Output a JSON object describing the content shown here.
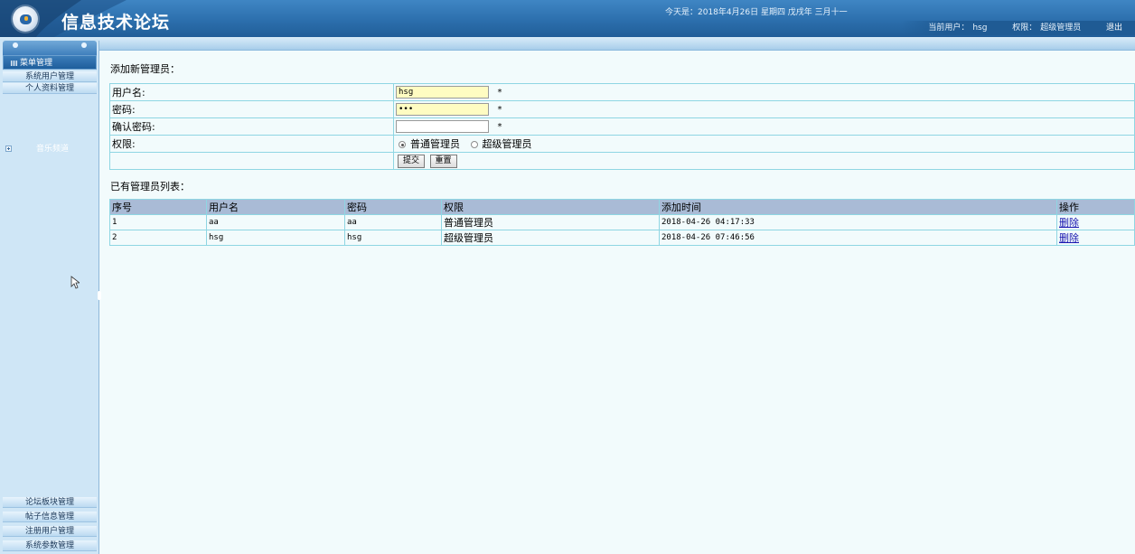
{
  "header": {
    "site_title": "信息技术论坛",
    "today_label": "今天是：2018年4月26日 星期四 戊戌年 三月十一",
    "current_user_label": "当前用户：",
    "current_user": "hsg",
    "role_label": "权限：",
    "role": "超级管理员",
    "logout": "退出"
  },
  "sidebar": {
    "menu_header": "菜单管理",
    "top_items": [
      "系统用户管理",
      "个人资料管理"
    ],
    "tree_item": "音乐频道",
    "bottom_items": [
      "论坛板块管理",
      "帖子信息管理",
      "注册用户管理",
      "系统参数管理"
    ]
  },
  "form": {
    "section_title": "添加新管理员：",
    "username_label": "用户名:",
    "username_value": "hsg",
    "password_label": "密码:",
    "password_value": "•••",
    "confirm_label": "确认密码:",
    "confirm_value": "",
    "required_mark": "*",
    "role_label": "权限:",
    "role_options": [
      "普通管理员",
      "超级管理员"
    ],
    "role_selected": "普通管理员",
    "submit_label": "提交",
    "reset_label": "重置"
  },
  "list": {
    "section_title": "已有管理员列表：",
    "columns": [
      "序号",
      "用户名",
      "密码",
      "权限",
      "添加时间",
      "操作"
    ],
    "rows": [
      {
        "id": "1",
        "username": "aa",
        "password": "aa",
        "role": "普通管理员",
        "added": "2018-04-26 04:17:33",
        "action": "删除"
      },
      {
        "id": "2",
        "username": "hsg",
        "password": "hsg",
        "role": "超级管理员",
        "added": "2018-04-26 07:46:56",
        "action": "删除"
      }
    ]
  },
  "colors": {
    "header_blue": "#2c6fad",
    "table_border": "#8fd6e3",
    "table_header": "#a9bbd6",
    "page_bg": "#f2fbfc",
    "input_highlight": "#fffcc2",
    "link": "#1b17b0"
  },
  "icons": [
    "logo-icon",
    "menu-grid-icon",
    "tree-expand-icon",
    "mouse-cursor-icon"
  ]
}
